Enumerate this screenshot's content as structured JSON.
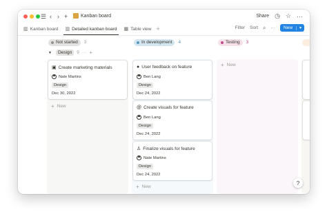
{
  "window": {
    "traffic_colors": [
      "#ff5f57",
      "#febc2e",
      "#28c840"
    ],
    "breadcrumb": "Kanban board",
    "share_label": "Share",
    "icons": [
      "sidebar-icon",
      "back-icon",
      "forward-icon",
      "add-icon",
      "clock-icon",
      "star-icon",
      "more-icon"
    ]
  },
  "views": {
    "tabs": [
      {
        "label": "Kanban board",
        "icon": "board-icon",
        "active": false
      },
      {
        "label": "Detailed kanban board",
        "icon": "board-icon",
        "active": true
      },
      {
        "label": "Table view",
        "icon": "table-icon",
        "active": false
      }
    ],
    "add_view": "+",
    "filter_label": "Filter",
    "sort_label": "Sort",
    "new_label": "New"
  },
  "columns": [
    {
      "label": "Not started",
      "count": "3",
      "color": "#e3e2e0",
      "dot": "#91918e",
      "bg": "#f7f7f5"
    },
    {
      "label": "In development",
      "count": "4",
      "color": "#d3e5ef",
      "dot": "#5b97bd",
      "bg": "#f5f9fb"
    },
    {
      "label": "Testing",
      "count": "3",
      "color": "#f5e0e9",
      "dot": "#c14c8a",
      "bg": "#fbf6f9"
    }
  ],
  "group": {
    "label": "Design",
    "count": "9"
  },
  "cards": {
    "not_started": [
      {
        "title": "Create marketing materials",
        "icon": "image-icon",
        "person": "Nate Martins",
        "tag": "Design",
        "date": "Dec 30, 2022"
      }
    ],
    "in_development": [
      {
        "title": "User feedback on feature",
        "icon": "chat-icon",
        "person": "Ben Lang",
        "tag": "Design",
        "date": "Dec 24, 2022"
      },
      {
        "title": "Create visuals for feature",
        "icon": "at-icon",
        "person": "Ben Lang",
        "tag": "Design",
        "date": "Dec 24, 2022"
      },
      {
        "title": "Finalize visuals for feature",
        "icon": "hierarchy-icon",
        "person": "Nate Martins",
        "tag": "Design",
        "date": "Dec 24, 2022"
      }
    ]
  },
  "new_label": "New",
  "help_label": "?"
}
